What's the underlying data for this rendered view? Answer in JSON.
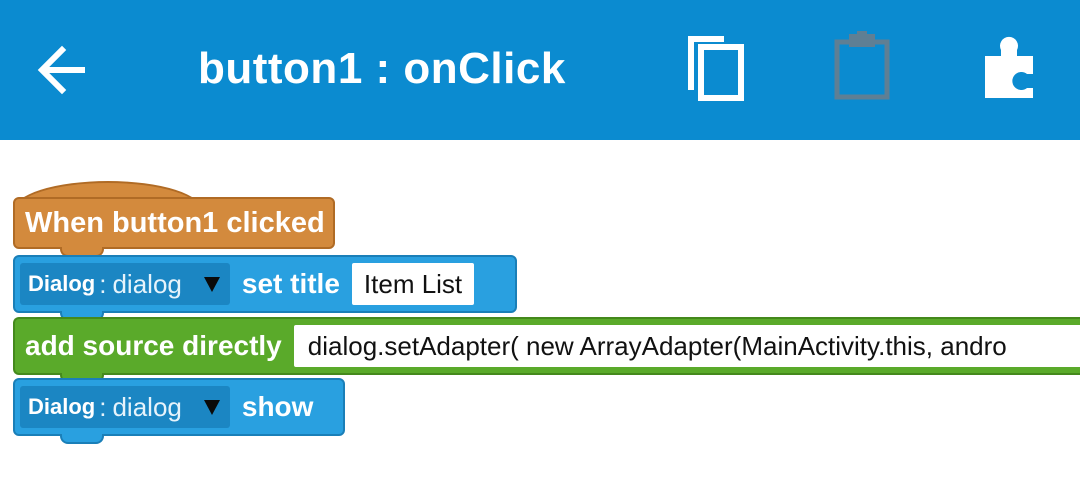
{
  "appbar": {
    "title": "button1 : onClick",
    "background": "#0b8bd0",
    "back_icon": "arrow-left-icon",
    "actions": [
      {
        "icon": "copy-icon",
        "enabled": true
      },
      {
        "icon": "clipboard-paste-icon",
        "enabled": false
      },
      {
        "icon": "puzzle-piece-icon",
        "enabled": true
      }
    ]
  },
  "blocks": {
    "event": {
      "label": "When button1 clicked",
      "color": "#d38a3d"
    },
    "set_title": {
      "component_type": "Dialog",
      "separator": ":",
      "component_name": "dialog",
      "label": "set title",
      "value": "Item List",
      "color": "#29a0e0"
    },
    "add_source": {
      "label": "add source directly",
      "code": "dialog.setAdapter( new ArrayAdapter(MainActivity.this, andro",
      "color": "#5aaa2a"
    },
    "show": {
      "component_type": "Dialog",
      "separator": ":",
      "component_name": "dialog",
      "label": "show",
      "color": "#29a0e0"
    }
  }
}
